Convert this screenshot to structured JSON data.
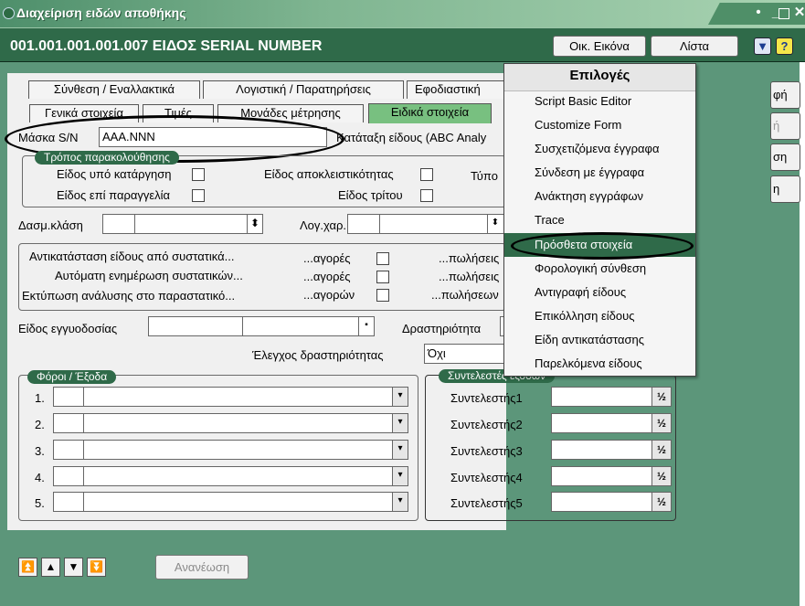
{
  "window": {
    "title": "Διαχείριση ειδών αποθήκης"
  },
  "header": {
    "title": "001.001.001.001.007 ΕΙΔΟΣ  SERIAL NUMBER",
    "btn_image": "Οικ. Εικόνα",
    "btn_list": "Λίστα",
    "menu_toggle_icon": "▼",
    "help_icon": "?"
  },
  "tabs_row1": [
    "Σύνθεση / Εναλλακτικά",
    "Λογιστική / Παρατηρήσεις",
    "Εφοδιαστική"
  ],
  "tabs_row2": [
    "Γενικά στοιχεία",
    "Τιμές",
    "Μονάδες μέτρησης",
    "Ειδικά στοιχεία"
  ],
  "serial": {
    "label": "Μάσκα S/N",
    "value": "AAA.NNN"
  },
  "classification_label": "Κατάταξη είδους (ABC Analy",
  "tracking": {
    "title": "Τρόπος παρακολούθησης",
    "withdrawal": "Είδος υπό κατάργηση",
    "exclusive": "Είδος αποκλειστικότητας",
    "type": "Τύπο",
    "on_order": "Είδος επί παραγγελία",
    "third_party": "Είδος τρίτου"
  },
  "tax_class_label": "Δασμ.κλάση",
  "acc_char_label": "Λογ.χαρ.",
  "replacement": {
    "row1": "Αντικατάσταση είδους από συστατικά...",
    "row2": "Αυτόματη ενημέρωση συστατικών...",
    "row3": "Εκτύπωση ανάλυσης στο παραστατικό...",
    "p1": "...αγορές",
    "p2": "...αγορές",
    "p3": "...αγορών",
    "s1": "...πωλήσεις",
    "s2": "...πωλήσεις",
    "s3": "...πωλήσεων"
  },
  "warranty_label": "Είδος εγγυοδοσίας",
  "activity_label": "Δραστηριότητα",
  "activity_check": {
    "label": "Έλεγχος δραστηριότητας",
    "value": "Όχι"
  },
  "taxes": {
    "title": "Φόροι / Έξοδα",
    "rows": [
      "1.",
      "2.",
      "3.",
      "4.",
      "5."
    ]
  },
  "coefficients": {
    "title": "Συντελεστές εξόδων",
    "rows": [
      "Συντελεστής1",
      "Συντελεστής2",
      "Συντελεστής3",
      "Συντελεστής4",
      "Συντελεστής5"
    ],
    "half_icon": "½"
  },
  "refresh_label": "Ανανέωση",
  "nav_icons": [
    "first",
    "previous",
    "next",
    "last"
  ],
  "menu": {
    "title": "Επιλογές",
    "items": [
      "Script Basic Editor",
      "Customize Form",
      "Συσχετιζόμενα έγγραφα",
      "Σύνδεση με έγγραφα",
      "Ανάκτηση εγγράφων",
      "Trace",
      "Πρόσθετα στοιχεία",
      "Φορολογική σύνθεση",
      "Αντιγραφή είδους",
      "Επικόλληση είδους",
      "Είδη αντικατάστασης",
      "Παρελκόμενα είδους"
    ],
    "selected_index": 6
  },
  "right_buttons": [
    "φή",
    "ή",
    "ση",
    "η"
  ],
  "colors": {
    "header": "#2f6a49",
    "body": "#5c967a",
    "tab_active": "#78c080"
  }
}
